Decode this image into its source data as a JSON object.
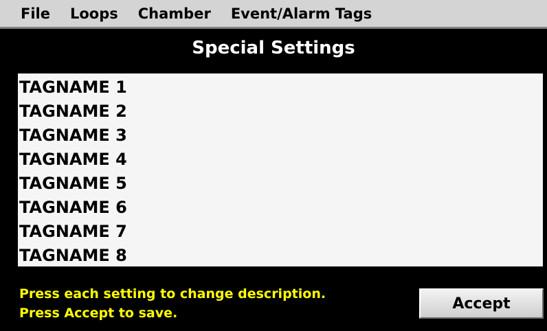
{
  "menu": {
    "items": [
      "File",
      "Loops",
      "Chamber",
      "Event/Alarm Tags"
    ]
  },
  "screen": {
    "title": "Special Settings"
  },
  "tags": [
    "TAGNAME 1",
    "TAGNAME 2",
    "TAGNAME 3",
    "TAGNAME 4",
    "TAGNAME 5",
    "TAGNAME 6",
    "TAGNAME 7",
    "TAGNAME 8"
  ],
  "instructions": {
    "line1": "Press each setting to change description.",
    "line2": "Press Accept to save."
  },
  "buttons": {
    "accept_label": "Accept"
  },
  "colors": {
    "background": "#000000",
    "menubar": "#d4d4d4",
    "list_background": "#f5f5f5",
    "instruction_text": "#ffff00",
    "title_text": "#ffffff"
  }
}
